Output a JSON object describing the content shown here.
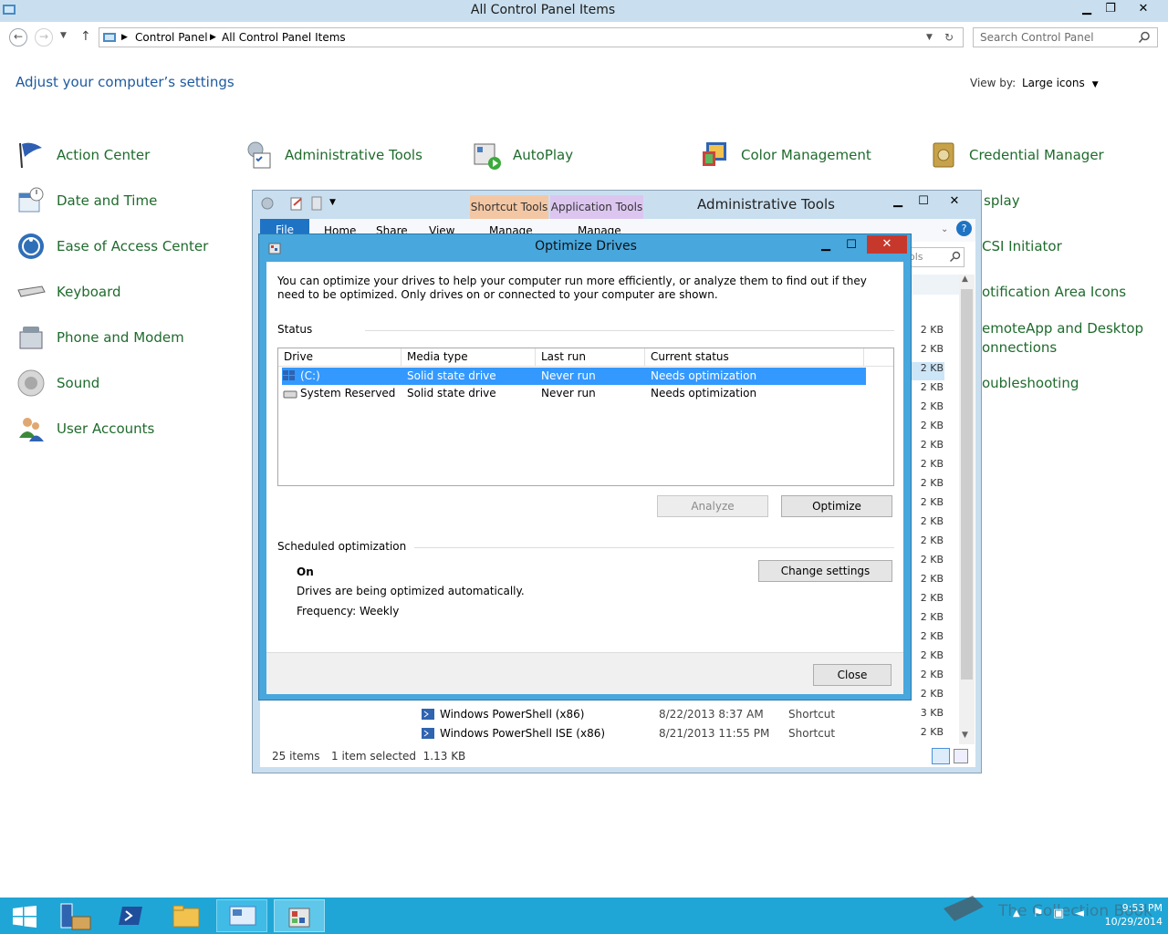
{
  "control_panel": {
    "title": "All Control Panel Items",
    "breadcrumb": [
      "Control Panel",
      "All Control Panel Items"
    ],
    "search_placeholder": "Search Control Panel",
    "heading": "Adjust your computer’s settings",
    "view_by_label": "View by:",
    "view_by_value": "Large icons",
    "items": [
      {
        "label": "Action Center"
      },
      {
        "label": "Administrative Tools"
      },
      {
        "label": "AutoPlay"
      },
      {
        "label": "Color Management"
      },
      {
        "label": "Credential Manager"
      },
      {
        "label": "Date and Time"
      },
      {
        "label": "Ease of Access Center"
      },
      {
        "label": "Keyboard"
      },
      {
        "label": "Phone and Modem"
      },
      {
        "label": "Sound"
      },
      {
        "label": "User Accounts"
      },
      {
        "label": "splay"
      },
      {
        "label": "CSI Initiator"
      },
      {
        "label": "otification Area Icons"
      },
      {
        "label": "emoteApp and Desktop"
      },
      {
        "label": "onnections"
      },
      {
        "label": "oubleshooting"
      }
    ]
  },
  "admin_tools": {
    "title": "Administrative Tools",
    "ribbon_contextual": [
      "Shortcut Tools",
      "Application Tools"
    ],
    "ribbon_tabs": [
      "File",
      "Home",
      "Share",
      "View",
      "Manage",
      "Manage"
    ],
    "search_fragment": "ols",
    "sizes": [
      "2 KB",
      "2 KB",
      "2 KB",
      "2 KB",
      "2 KB",
      "2 KB",
      "2 KB",
      "2 KB",
      "2 KB",
      "2 KB",
      "2 KB",
      "2 KB",
      "2 KB",
      "2 KB",
      "2 KB",
      "2 KB",
      "2 KB",
      "2 KB",
      "2 KB",
      "2 KB",
      "3 KB",
      "2 KB"
    ],
    "rows": [
      {
        "name": "Windows PowerShell (x86)",
        "date": "8/22/2013 8:37 AM",
        "type": "Shortcut"
      },
      {
        "name": "Windows PowerShell ISE (x86)",
        "date": "8/21/2013 11:55 PM",
        "type": "Shortcut"
      }
    ],
    "status_items": "25 items",
    "status_selected": "1 item selected  1.13 KB"
  },
  "optimize": {
    "title": "Optimize Drives",
    "intro": "You can optimize your drives to help your computer run more efficiently, or analyze them to find out if they need to be optimized. Only drives on or connected to your computer are shown.",
    "status_label": "Status",
    "columns": [
      "Drive",
      "Media type",
      "Last run",
      "Current status"
    ],
    "drives": [
      {
        "drive": "(C:)",
        "media": "Solid state drive",
        "last_run": "Never run",
        "status": "Needs optimization"
      },
      {
        "drive": "System Reserved",
        "media": "Solid state drive",
        "last_run": "Never run",
        "status": "Needs optimization"
      }
    ],
    "analyze_label": "Analyze",
    "optimize_label": "Optimize",
    "scheduled_label": "Scheduled optimization",
    "sched_state": "On",
    "sched_desc": "Drives are being optimized automatically.",
    "sched_freq": "Frequency: Weekly",
    "change_settings_label": "Change settings",
    "close_label": "Close"
  },
  "taskbar": {
    "clock_time": "9:53 PM",
    "clock_date": "10/29/2014",
    "watermark": "The Collection Book"
  },
  "colors": {
    "titlebar": "#c9dfef",
    "dialog_frame": "#48a7dd",
    "selection": "#3399ff",
    "link_green": "#1f6b2d",
    "heading_blue": "#1e5aa0",
    "close_red": "#c7382c",
    "taskbar": "#1fa6d6"
  }
}
